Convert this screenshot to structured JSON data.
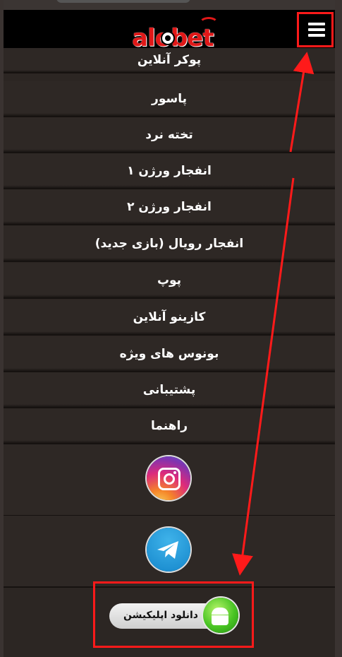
{
  "header": {
    "logo_text": "alobet",
    "menu_icon": "hamburger-menu-icon"
  },
  "menu": {
    "items": [
      {
        "label": "پوکر آنلاین"
      },
      {
        "label": "پاسور"
      },
      {
        "label": "تخته نرد"
      },
      {
        "label": "انفجار ورژن ۱"
      },
      {
        "label": "انفجار ورژن ۲"
      },
      {
        "label": "انفجار رویال (بازی جدید)"
      },
      {
        "label": "پوپ"
      },
      {
        "label": "کازینو آنلاین"
      },
      {
        "label": "بونوس های ویژه"
      },
      {
        "label": "پشتیبانی"
      },
      {
        "label": "راهنما"
      }
    ],
    "social": [
      {
        "name": "instagram-icon"
      },
      {
        "name": "telegram-icon"
      }
    ],
    "download": {
      "label": "دانلود اپلیکیشن",
      "icon": "android-icon"
    }
  },
  "colors": {
    "header_bg": "#000000",
    "menu_bg": "#2e2825",
    "annotation_red": "#ff1a1a",
    "logo_red": "#e01818"
  }
}
